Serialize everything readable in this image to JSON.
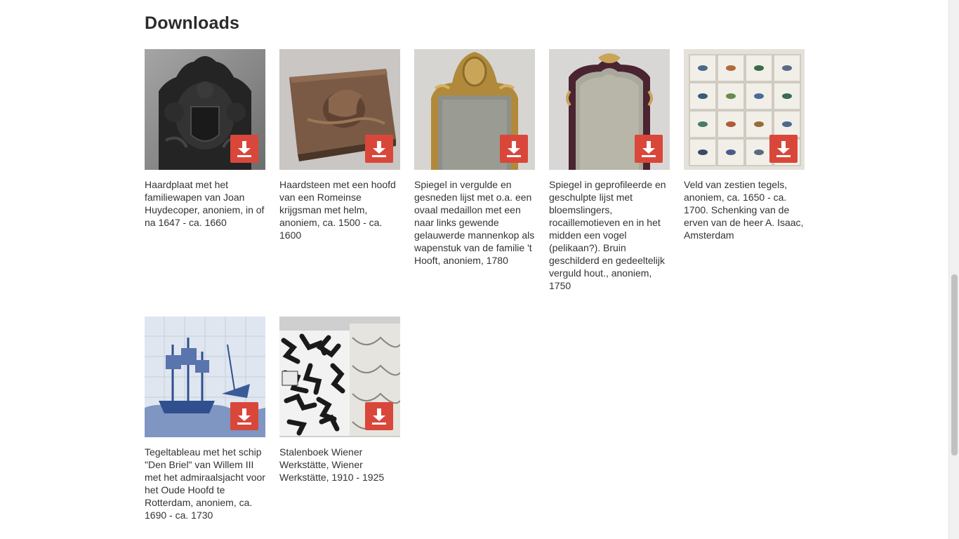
{
  "section": {
    "title": "Downloads"
  },
  "items": [
    {
      "caption": "Haardplaat met het familiewapen van Joan Huydecoper, anoniem, in of na 1647 - ca. 1660",
      "icon": "download-icon"
    },
    {
      "caption": "Haardsteen met een hoofd van een Romeinse krijgsman met helm, anoniem, ca. 1500 - ca. 1600",
      "icon": "download-icon"
    },
    {
      "caption": "Spiegel in vergulde en gesneden lijst met o.a. een ovaal medaillon met een naar links gewende gelauwerde mannenkop als wapenstuk van de familie 't Hooft, anoniem, 1780",
      "icon": "download-icon"
    },
    {
      "caption": "Spiegel in geprofileerde en geschulpte lijst met bloemslingers, rocaillemotieven en in het midden een vogel (pelikaan?). Bruin geschilderd en gedeeltelijk verguld hout., anoniem, 1750",
      "icon": "download-icon"
    },
    {
      "caption": "Veld van zestien tegels, anoniem, ca. 1650 - ca. 1700. Schenking van de erven van de heer A. Isaac, Amsterdam",
      "icon": "download-icon"
    },
    {
      "caption": "Tegeltableau met het schip \"Den Briel\" van Willem III met het admiraalsjacht voor het Oude Hoofd te Rotterdam, anoniem, ca. 1690 - ca. 1730",
      "icon": "download-icon"
    },
    {
      "caption": "Stalenboek Wiener Werkstätte, Wiener Werkstätte, 1910 - 1925",
      "icon": "download-icon"
    }
  ],
  "colors": {
    "accent": "#d9473a",
    "text": "#333333"
  }
}
